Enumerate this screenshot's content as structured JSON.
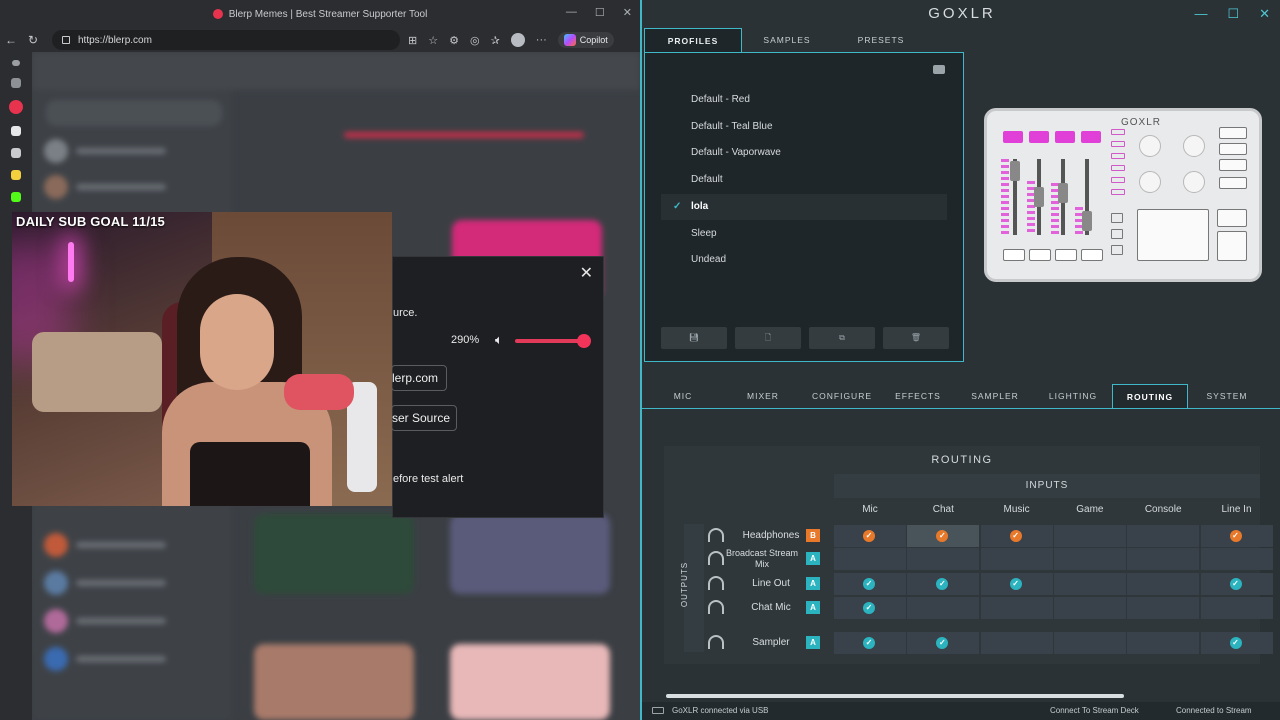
{
  "browser": {
    "window_title": "Blerp Memes | Best Streamer Supporter Tool",
    "url": "https://blerp.com",
    "copilot_label": "Copilot"
  },
  "overlay": {
    "goal_label": "DAILY SUB GOAL 11/15"
  },
  "dialog": {
    "line_fragment": "urce.",
    "volume_percent": "290%",
    "button1_text": "lerp.com",
    "button2_text": "ser Source",
    "footer_fragment": "efore test alert",
    "slider_value": 1.0
  },
  "goxlr": {
    "app_title": "GOXLR",
    "top_tabs": [
      "PROFILES",
      "SAMPLES",
      "PRESETS"
    ],
    "profiles": [
      {
        "name": "Default - Red",
        "selected": false
      },
      {
        "name": "Default - Teal Blue",
        "selected": false
      },
      {
        "name": "Default - Vaporwave",
        "selected": false
      },
      {
        "name": "Default",
        "selected": false
      },
      {
        "name": "lola",
        "selected": true
      },
      {
        "name": "Sleep",
        "selected": false
      },
      {
        "name": "Undead",
        "selected": false
      }
    ],
    "device_logo": "GOXLR",
    "main_tabs": [
      "MIC",
      "MIXER",
      "CONFIGURE",
      "EFFECTS",
      "SAMPLER",
      "LIGHTING",
      "ROUTING",
      "SYSTEM"
    ],
    "active_tab": "ROUTING",
    "routing": {
      "title": "ROUTING",
      "inputs_label": "INPUTS",
      "outputs_label": "OUTPUTS",
      "columns": [
        "Mic",
        "Chat",
        "Music",
        "Game",
        "Console",
        "Line In"
      ],
      "rows": [
        {
          "label": "Headphones",
          "badge": "B",
          "badge_color": "#e8792a",
          "checks": [
            true,
            true,
            true,
            false,
            false,
            true
          ],
          "check_color": "#e8792a"
        },
        {
          "label": "Broadcast Stream Mix",
          "badge": "A",
          "badge_color": "#2bb3bf",
          "checks": [
            false,
            false,
            false,
            false,
            false,
            false
          ],
          "check_color": "#2bb3bf"
        },
        {
          "label": "Line Out",
          "badge": "A",
          "badge_color": "#2bb3bf",
          "checks": [
            true,
            true,
            true,
            false,
            false,
            true
          ],
          "check_color": "#2bb3bf"
        },
        {
          "label": "Chat Mic",
          "badge": "A",
          "badge_color": "#2bb3bf",
          "checks": [
            true,
            false,
            false,
            false,
            false,
            false
          ],
          "check_color": "#2bb3bf"
        },
        {
          "label": "Sampler",
          "badge": "A",
          "badge_color": "#2bb3bf",
          "checks": [
            true,
            true,
            false,
            false,
            false,
            true
          ],
          "check_color": "#2bb3bf"
        }
      ]
    },
    "status": {
      "usb": "GoXLR connected via USB",
      "stream_deck": "Connect To Stream Deck",
      "stream": "Connected to Stream"
    }
  }
}
